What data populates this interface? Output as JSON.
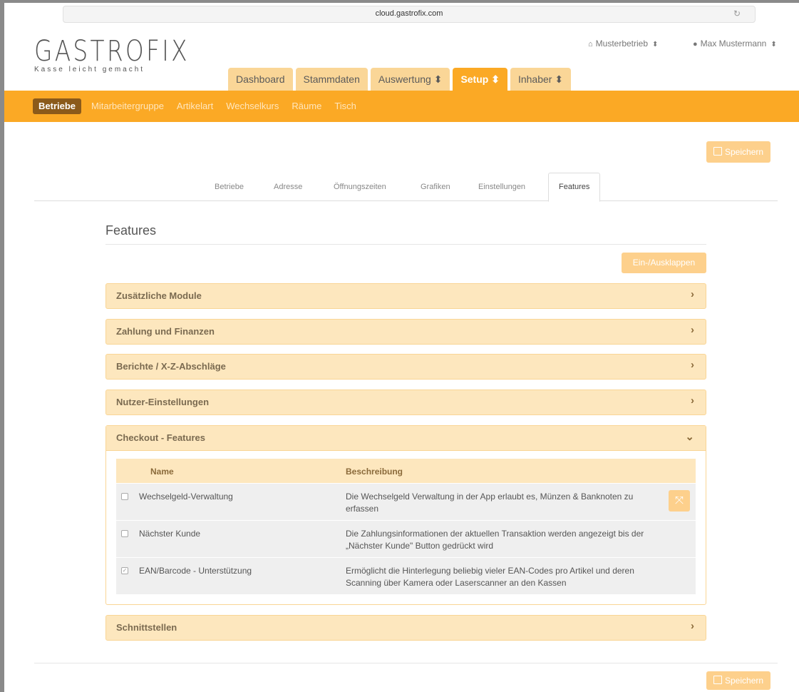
{
  "browser": {
    "url": "cloud.gastrofix.com",
    "reload_icon": "reload-icon"
  },
  "brand": {
    "logo": "GASTROFIX",
    "tagline": "Kasse leicht gemacht"
  },
  "account": {
    "business": "Musterbetrieb",
    "business_icon": "home-icon",
    "user": "Max Mustermann",
    "user_icon": "user-icon",
    "select_symbol": "⬍"
  },
  "main_tabs": [
    {
      "label": "Dashboard"
    },
    {
      "label": "Stammdaten"
    },
    {
      "label": "Auswertung ⬍"
    },
    {
      "label": "Setup ⬍"
    },
    {
      "label": "Inhaber ⬍"
    }
  ],
  "sub_nav": [
    "Betriebe",
    "Mitarbeitergruppe",
    "Artikelart",
    "Wechselkurs",
    "Räume",
    "Tisch"
  ],
  "save_label": "Speichern",
  "sub_tabs": [
    "Betriebe",
    "Adresse",
    "Öffnungszeiten",
    "Grafiken",
    "Einstellungen",
    "Features"
  ],
  "section_title": "Features",
  "toggle_label": "Ein-/Ausklappen",
  "panels": [
    {
      "title": "Zusätzliche Module"
    },
    {
      "title": "Zahlung und Finanzen"
    },
    {
      "title": "Berichte / X-Z-Abschläge"
    },
    {
      "title": "Nutzer-Einstellungen"
    },
    {
      "title": "Checkout - Features"
    },
    {
      "title": "Schnittstellen"
    }
  ],
  "feature_table": {
    "headers": {
      "name": "Name",
      "description": "Beschreibung"
    },
    "rows": [
      {
        "name": "Wechselgeld-Verwaltung",
        "description": "Die Wechselgeld Verwaltung in der App erlaubt es, Münzen & Banknoten zu erfassen",
        "checked": false,
        "mark": ""
      },
      {
        "name": "Nächster Kunde",
        "description": "Die Zahlungsinformationen der aktuellen Transaktion werden angezeigt bis der „Nächster Kunde\" Button gedrückt wird",
        "checked": false,
        "mark": ""
      },
      {
        "name": "EAN/Barcode - Unterstützung",
        "description": "Ermöglicht die Hinterlegung beliebig vieler EAN-Codes pro Artikel und deren Scanning über Kamera oder Laserscanner an den Kassen",
        "checked": true,
        "mark": "✓"
      }
    ]
  },
  "colors": {
    "accent": "#fba925",
    "accent_light": "#fde7be",
    "active_subnav": "#8b5a1a",
    "button": "#fdd08c"
  }
}
